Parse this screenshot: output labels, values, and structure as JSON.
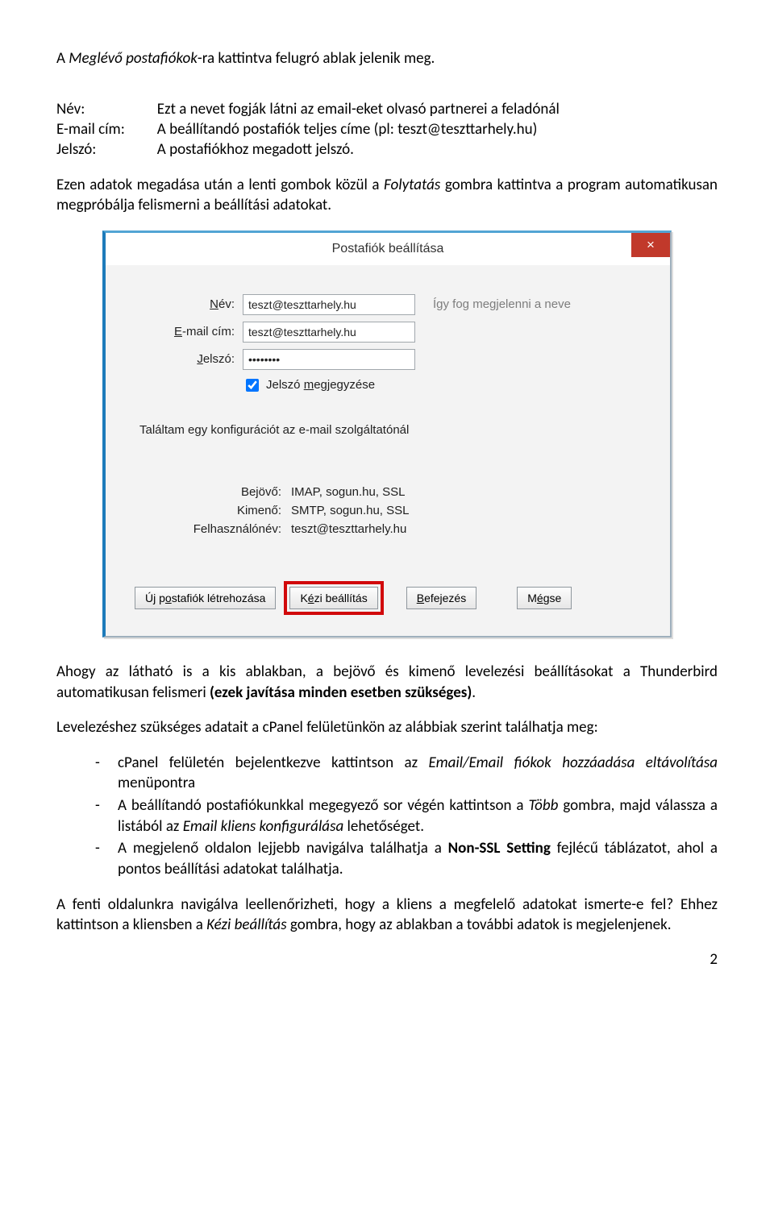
{
  "intro": {
    "p1_a": "A ",
    "p1_b": "Meglévő postafiókok",
    "p1_c": "-ra kattintva felugró ablak jelenik meg."
  },
  "defs": {
    "name_label": "Név:",
    "name_value": "Ezt a nevet fogják látni az email-eket olvasó partnerei a feladónál",
    "email_label": "E-mail cím:",
    "email_value": "A beállítandó postafiók teljes címe (pl: teszt@teszttarhely.hu)",
    "pw_label": "Jelszó:",
    "pw_value": "A postafiókhoz megadott jelszó."
  },
  "p2_a": "Ezen adatok megadása után a lenti gombok közül a ",
  "p2_b": "Folytatás",
  "p2_c": " gombra kattintva a program automatikusan megpróbálja felismerni a beállítási adatokat.",
  "dialog": {
    "title": "Postafiók beállítása",
    "close": "×",
    "name_label": "Név:",
    "name_value": "teszt@teszttarhely.hu",
    "name_hint": "Így fog megjelenni a neve",
    "email_label": "E-mail cím:",
    "email_value": "teszt@teszttarhely.hu",
    "pw_label": "Jelszó:",
    "pw_value": "••••••••",
    "remember": "Jelszó megjegyzése",
    "found": "Találtam egy konfigurációt az e-mail szolgáltatónál",
    "in_label": "Bejövő:",
    "in_value": "IMAP, sogun.hu, SSL",
    "out_label": "Kimenő:",
    "out_value": "SMTP, sogun.hu, SSL",
    "user_label": "Felhasználónév:",
    "user_value": "teszt@teszttarhely.hu",
    "btn_new_a": "Új p",
    "btn_new_b": "o",
    "btn_new_c": "stafiók létrehozása",
    "btn_manual_a": "K",
    "btn_manual_b": "é",
    "btn_manual_c": "zi beállítás",
    "btn_done_a": "B",
    "btn_done_b": "efejezés",
    "btn_cancel_a": "M",
    "btn_cancel_b": "é",
    "btn_cancel_c": "gse"
  },
  "p3_a": "Ahogy az látható is a kis ablakban, a bejövő és kimenő levelezési beállításokat a Thunderbird automatikusan felismeri ",
  "p3_b": "(ezek javítása minden esetben szükséges)",
  "p3_c": ".",
  "p4": "Levelezéshez szükséges adatait a cPanel felületünkön az alábbiak szerint találhatja meg:",
  "bullets": {
    "b1_a": "cPanel felületén bejelentkezve kattintson az ",
    "b1_b": "Email/Email fiókok hozzáadása eltávolítása",
    "b1_c": " menüpontra",
    "b2_a": "A beállítandó postafiókunkkal megegyező sor végén kattintson a ",
    "b2_b": "Több",
    "b2_c": " gombra, majd válassza a listából az ",
    "b2_d": "Email kliens konfigurálása",
    "b2_e": " lehetőséget.",
    "b3_a": "A megjelenő oldalon lejjebb navigálva találhatja a ",
    "b3_b": "Non-SSL Setting",
    "b3_c": " fejlécű táblázatot, ahol a pontos beállítási adatokat találhatja."
  },
  "p5_a": "A fenti oldalunkra navigálva leellenőrizheti, hogy a kliens a megfelelő adatokat ismerte-e fel? Ehhez kattintson a kliensben a ",
  "p5_b": "Kézi beállítás",
  "p5_c": " gombra, hogy az ablakban a további adatok is megjelenjenek.",
  "page_no": "2"
}
